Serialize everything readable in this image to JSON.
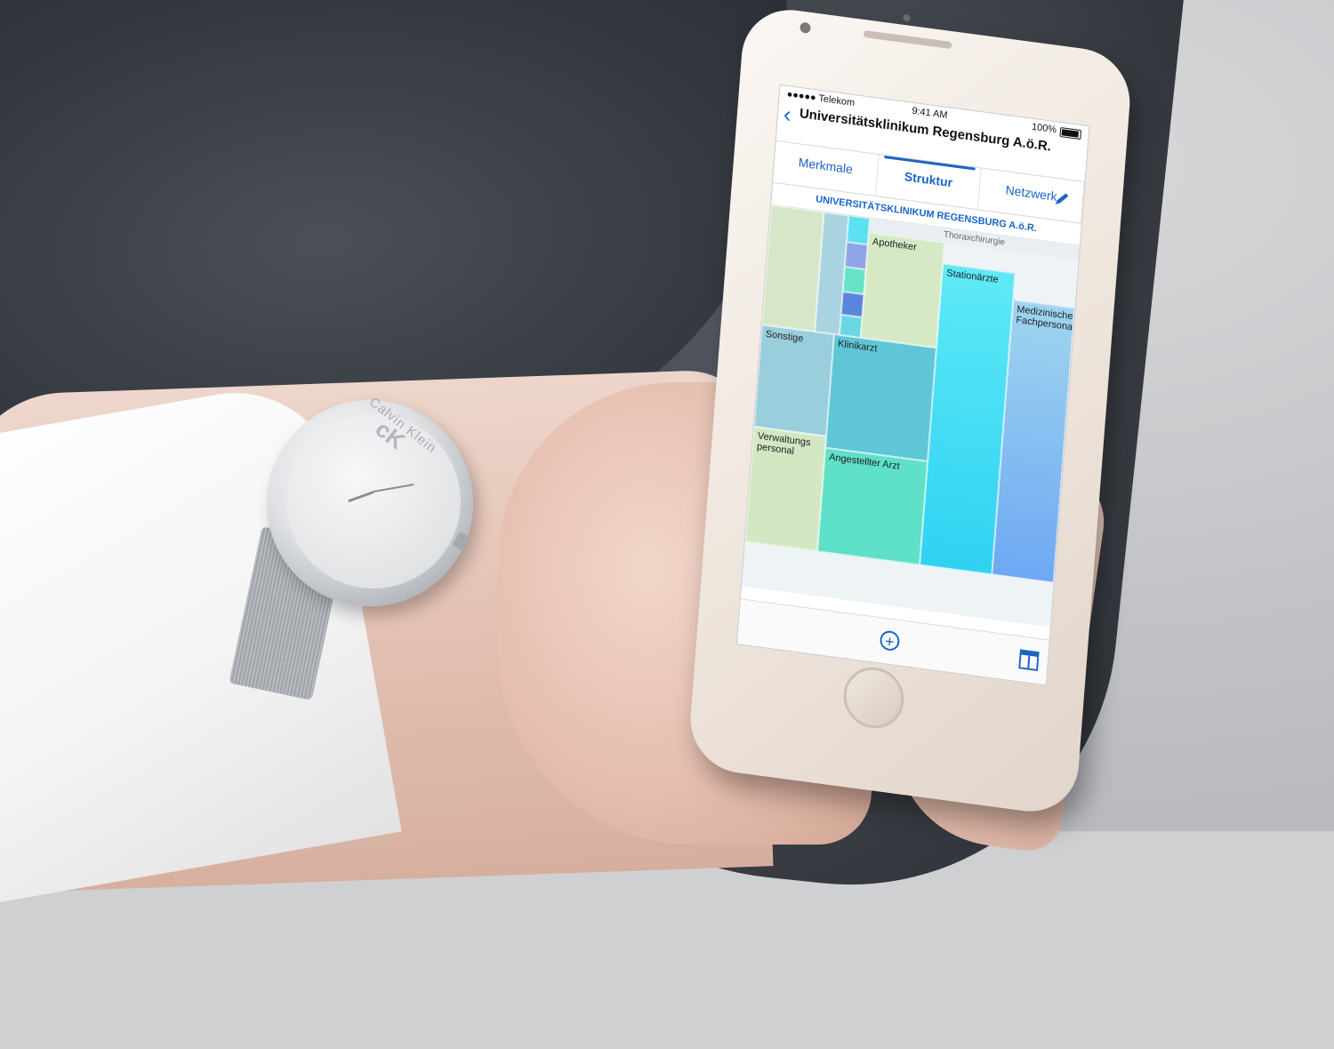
{
  "status_bar": {
    "carrier": "●●●●● Telekom",
    "time": "9:41 AM",
    "battery": "100%"
  },
  "nav": {
    "title": "Universitätsklinikum Regensburg A.ö.R."
  },
  "tabs": [
    {
      "label": "Merkmale"
    },
    {
      "label": "Struktur"
    },
    {
      "label": "Netzwerk"
    }
  ],
  "org_header": "UNIVERSITÄTSKLINIKUM REGENSBURG A.ö.R.",
  "banner": "Thoraxchirurgie",
  "treemap": {
    "apotheker": "Apotheker",
    "stationaerzte": "Stationärzte",
    "medizinisches": "Medizinisches Fachpersonal",
    "sonstige": "Sonstige",
    "klinikarzt": "Klinikarzt",
    "verwaltung": "Verwaltungs personal",
    "angestellter": "Angestellter Arzt"
  },
  "watch": {
    "brand": "Calvin Klein",
    "mono": "cK"
  },
  "colors": {
    "accent": "#1a66c2"
  },
  "icons": {
    "back": "chevron-left-icon",
    "edit": "pencil-icon",
    "add": "plus-circle-icon",
    "layout": "layout-icon",
    "wifi": "wifi-icon",
    "battery": "battery-icon"
  }
}
